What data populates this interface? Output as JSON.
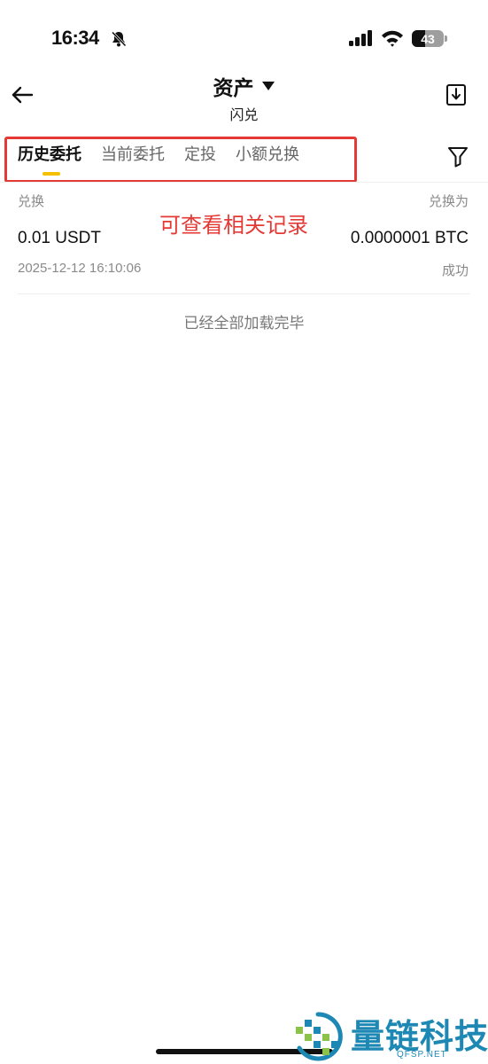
{
  "status_bar": {
    "time": "16:34",
    "battery": "43",
    "battery_level": 0.43,
    "icons": [
      "bell-slash-icon",
      "signal-icon",
      "wifi-icon",
      "battery-icon"
    ]
  },
  "header": {
    "title": "资产",
    "subtitle": "闪兑",
    "icons": [
      "back-arrow-icon",
      "caret-down-icon",
      "download-icon"
    ]
  },
  "tabs": [
    {
      "label": "历史委托",
      "active": true
    },
    {
      "label": "当前委托",
      "active": false
    },
    {
      "label": "定投",
      "active": false
    },
    {
      "label": "小额兑换",
      "active": false
    }
  ],
  "filter_icon": "filter-icon",
  "annotation": {
    "text": "可查看相关记录",
    "color": "#e53935"
  },
  "record": {
    "from_label": "兑换",
    "to_label": "兑换为",
    "from_amount": "0.01 USDT",
    "to_amount": "0.0000001 BTC",
    "time": "2025-12-12 16:10:06",
    "status": "成功"
  },
  "list_footer": "已经全部加载完毕",
  "watermark": {
    "text": "量链科技",
    "sub": "QFSP.NET",
    "color": "#1e88b4"
  },
  "colors": {
    "accent": "#f5c000",
    "text_primary": "#111111",
    "text_secondary": "#8a8a8a"
  }
}
